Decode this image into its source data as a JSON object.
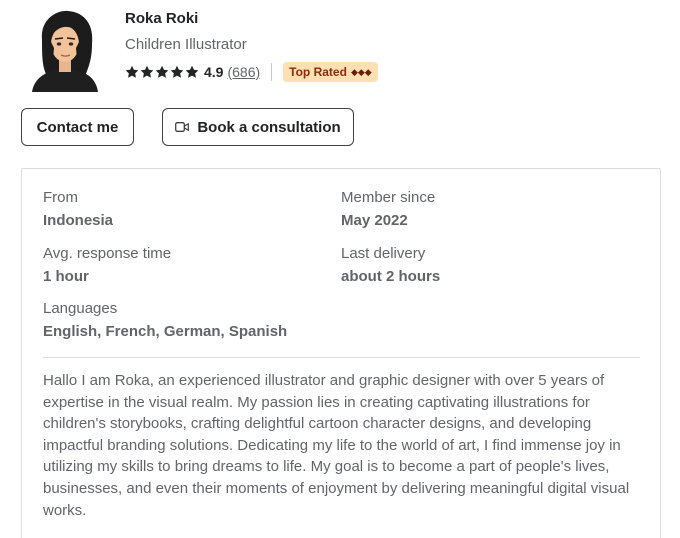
{
  "profile": {
    "name": "Roka Roki",
    "title": "Children Illustrator",
    "rating": "4.9",
    "reviews": "(686)",
    "badge_label": "Top Rated",
    "badge_diamonds": "◆◆◆"
  },
  "actions": {
    "contact_label": "Contact me",
    "consult_label": "Book a consultation"
  },
  "info": {
    "from_label": "From",
    "from_value": "Indonesia",
    "member_label": "Member since",
    "member_value": "May 2022",
    "response_label": "Avg. response time",
    "response_value": "1 hour",
    "delivery_label": "Last delivery",
    "delivery_value": "about 2 hours",
    "languages_label": "Languages",
    "languages_value": "English, French, German, Spanish"
  },
  "description": "Hallo I am Roka, an experienced illustrator and graphic designer with over 5 years of expertise in the visual realm. My passion lies in creating captivating illustrations for children's storybooks, crafting delightful cartoon character designs, and developing impactful branding solutions. Dedicating my life to the world of art, I find immense joy in utilizing my skills to bring dreams to life. My goal is to become a part of people's lives, businesses, and even their moments of enjoyment by delivering meaningful digital visual works.",
  "icons": {
    "star": "star-icon",
    "video": "video-camera-icon"
  },
  "colors": {
    "badge_bg": "#ffe0b3",
    "badge_text": "#8a2c0d",
    "text_primary": "#222325",
    "text_secondary": "#62646a"
  }
}
